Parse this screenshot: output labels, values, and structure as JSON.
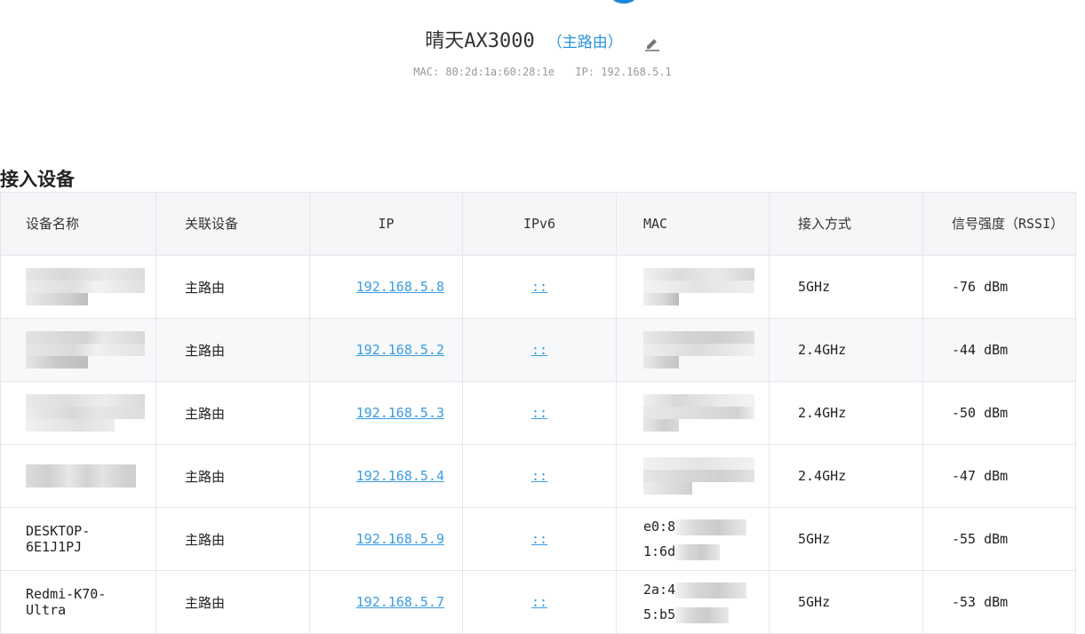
{
  "router": {
    "name": "晴天AX3000",
    "role": "（主路由）",
    "mac": "MAC: 80:2d:1a:60:28:1e",
    "ip": "IP: 192.168.5.1"
  },
  "section_title": "接入设备",
  "table": {
    "headers": [
      "设备名称",
      "关联设备",
      "IP",
      "IPv6",
      "MAC",
      "接入方式",
      "信号强度（RSSI）"
    ],
    "rows": [
      {
        "name": "",
        "parent": "主路由",
        "ip": "192.168.5.8",
        "ipv6": "::",
        "mac_line1": "",
        "mac_line2": "",
        "mode": "5GHz",
        "rssi": "-76 dBm"
      },
      {
        "name": "",
        "parent": "主路由",
        "ip": "192.168.5.2",
        "ipv6": "::",
        "mac_line1": "",
        "mac_line2": "",
        "mode": "2.4GHz",
        "rssi": "-44 dBm"
      },
      {
        "name": "",
        "parent": "主路由",
        "ip": "192.168.5.3",
        "ipv6": "::",
        "mac_line1": "",
        "mac_line2": "",
        "mode": "2.4GHz",
        "rssi": "-50 dBm"
      },
      {
        "name": "",
        "parent": "主路由",
        "ip": "192.168.5.4",
        "ipv6": "::",
        "mac_line1": "",
        "mac_line2": "",
        "mode": "2.4GHz",
        "rssi": "-47 dBm"
      },
      {
        "name": "DESKTOP-6E1J1PJ",
        "parent": "主路由",
        "ip": "192.168.5.9",
        "ipv6": "::",
        "mac_line1": "e0:8",
        "mac_line2": "1:6d",
        "mode": "5GHz",
        "rssi": "-55 dBm"
      },
      {
        "name": "Redmi-K70-Ultra",
        "parent": "主路由",
        "ip": "192.168.5.7",
        "ipv6": "::",
        "mac_line1": "2a:4",
        "mac_line2": "5:b5",
        "mode": "5GHz",
        "rssi": "-53 dBm"
      }
    ]
  },
  "colors": {
    "accent": "#2a95d9",
    "link": "#3a9be0",
    "header_bg": "#f5f6f8",
    "border": "#e4e6ea"
  },
  "icons": {
    "edit": "pencil-icon"
  }
}
